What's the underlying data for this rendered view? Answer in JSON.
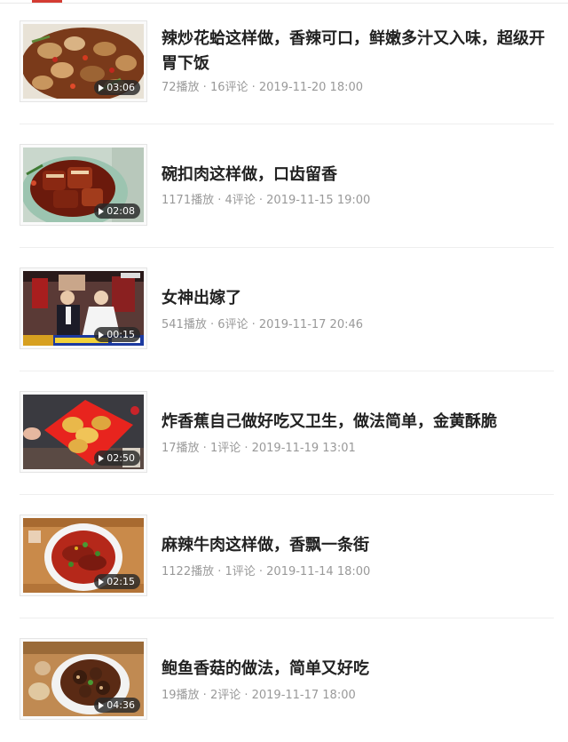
{
  "items": [
    {
      "title": "辣炒花蛤这样做，香辣可口，鲜嫩多汁又入味，超级开胃下饭",
      "meta": "72播放 · 16评论 · 2019-11-20 18:00",
      "duration": "03:06"
    },
    {
      "title": "碗扣肉这样做，口齿留香",
      "meta": "1171播放 · 4评论 · 2019-11-15 19:00",
      "duration": "02:08"
    },
    {
      "title": "女神出嫁了",
      "meta": "541播放 · 6评论 · 2019-11-17 20:46",
      "duration": "00:15"
    },
    {
      "title": "炸香蕉自己做好吃又卫生，做法简单，金黄酥脆",
      "meta": "17播放 · 1评论 · 2019-11-19 13:01",
      "duration": "02:50"
    },
    {
      "title": "麻辣牛肉这样做，香飘一条街",
      "meta": "1122播放 · 1评论 · 2019-11-14 18:00",
      "duration": "02:15"
    },
    {
      "title": "鲍鱼香菇的做法，简单又好吃",
      "meta": "19播放 · 2评论 · 2019-11-17 18:00",
      "duration": "04:36"
    }
  ],
  "colors": {
    "accent": "#d43c33",
    "title": "#222222",
    "meta": "#999999"
  }
}
